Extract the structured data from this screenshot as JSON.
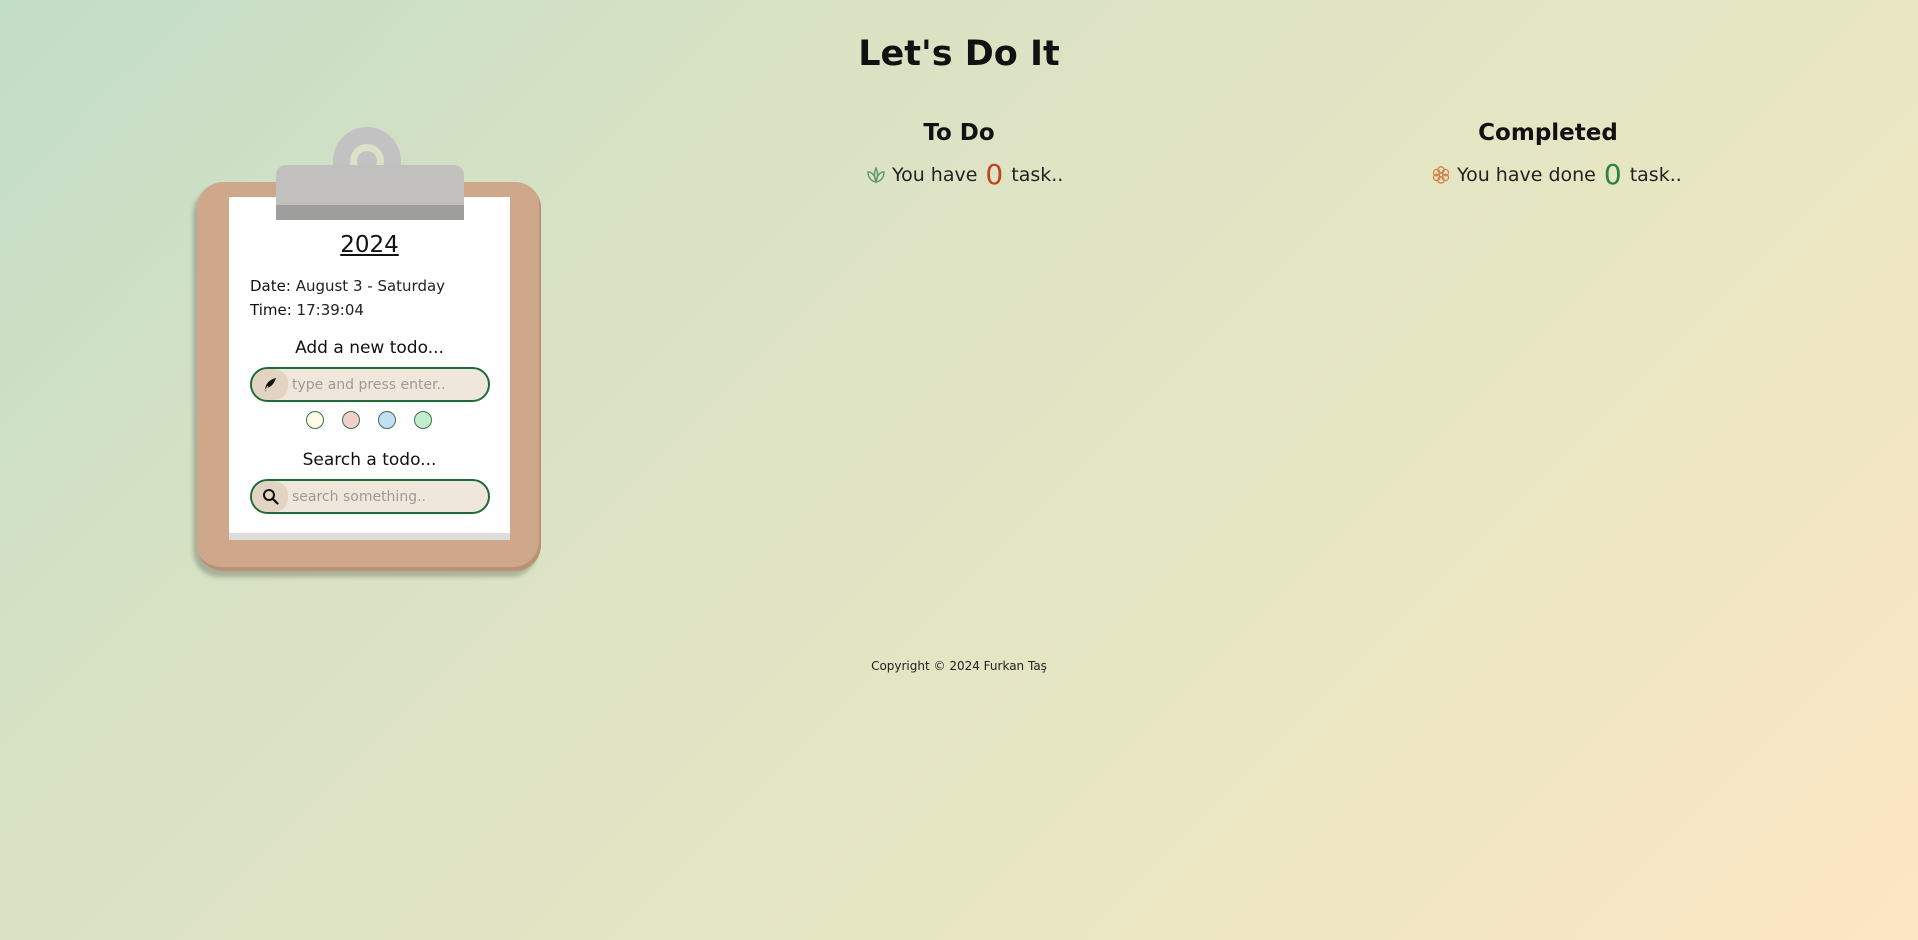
{
  "header": {
    "title": "Let's Do It"
  },
  "clipboard": {
    "year": "2024",
    "date_label": "Date:",
    "date_value": "August 3 - Saturday",
    "time_label": "Time:",
    "time_value": "17:39:04",
    "add_label": "Add a new todo...",
    "add_placeholder": "type and press enter..",
    "colors": [
      "#fbfbe6",
      "#f3cfca",
      "#c3dff5",
      "#c4edcf"
    ],
    "search_label": "Search a todo...",
    "search_placeholder": "search something.."
  },
  "todo": {
    "heading": "To Do",
    "prefix": "You have",
    "count": "0",
    "suffix": "task..",
    "count_color": "#c0451f"
  },
  "completed": {
    "heading": "Completed",
    "prefix": "You have done",
    "count": "0",
    "suffix": "task..",
    "count_color": "#2e8045"
  },
  "footer": {
    "text": "Copyright © 2024 Furkan Taş"
  }
}
